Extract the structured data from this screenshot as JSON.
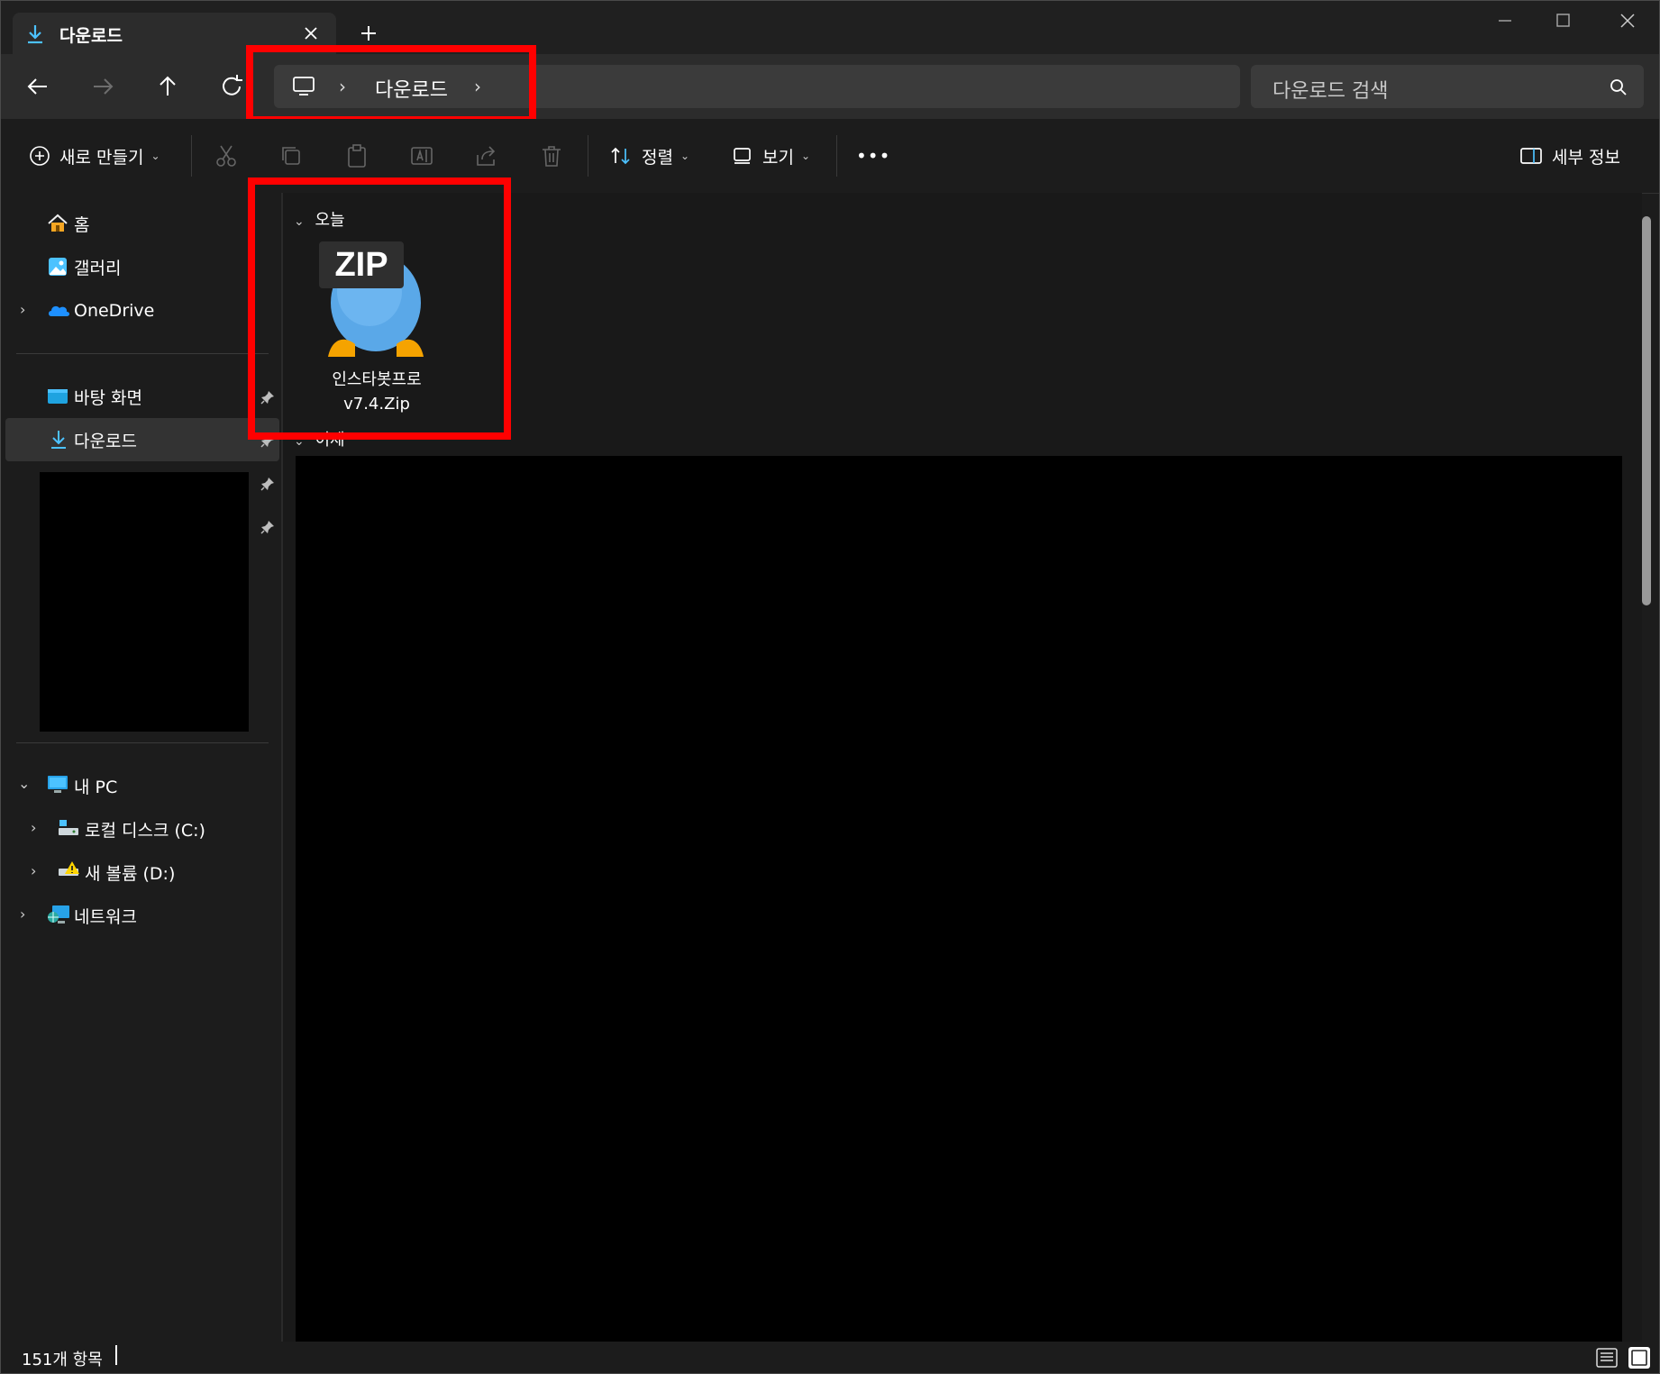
{
  "tab": {
    "title": "다운로드",
    "new_tab_label": "+"
  },
  "address": {
    "crumbs": [
      "다운로드"
    ],
    "separator": "›"
  },
  "search": {
    "placeholder": "다운로드 검색"
  },
  "commands": {
    "new": "새로 만들기",
    "sort": "정렬",
    "view": "보기",
    "more": "•••",
    "details": "세부 정보"
  },
  "sidebar": {
    "quick": [
      {
        "label": "홈",
        "icon": "home-icon"
      },
      {
        "label": "갤러리",
        "icon": "gallery-icon"
      },
      {
        "label": "OneDrive",
        "icon": "onedrive-icon"
      }
    ],
    "pinned": [
      {
        "label": "바탕 화면",
        "icon": "desktop-folder-icon"
      },
      {
        "label": "다운로드",
        "icon": "download-icon",
        "selected": true
      }
    ],
    "this_pc": {
      "label": "내 PC",
      "drives": [
        {
          "label": "로컬 디스크 (C:)",
          "icon": "local-disk-icon"
        },
        {
          "label": "새 볼륨 (D:)",
          "icon": "volume-icon"
        }
      ]
    },
    "network": {
      "label": "네트워크",
      "icon": "network-icon"
    }
  },
  "content": {
    "groups": [
      {
        "header": "오늘",
        "files": [
          {
            "name_line1": "인스타봇프로",
            "name_line2": "v7.4.Zip",
            "badge": "ZIP"
          }
        ]
      },
      {
        "header": "이제"
      }
    ]
  },
  "status": {
    "item_count": "151개 항목"
  },
  "colors": {
    "accent": "#4cc2ff",
    "highlight": "#ff0000",
    "background": "#1c1c1c"
  }
}
